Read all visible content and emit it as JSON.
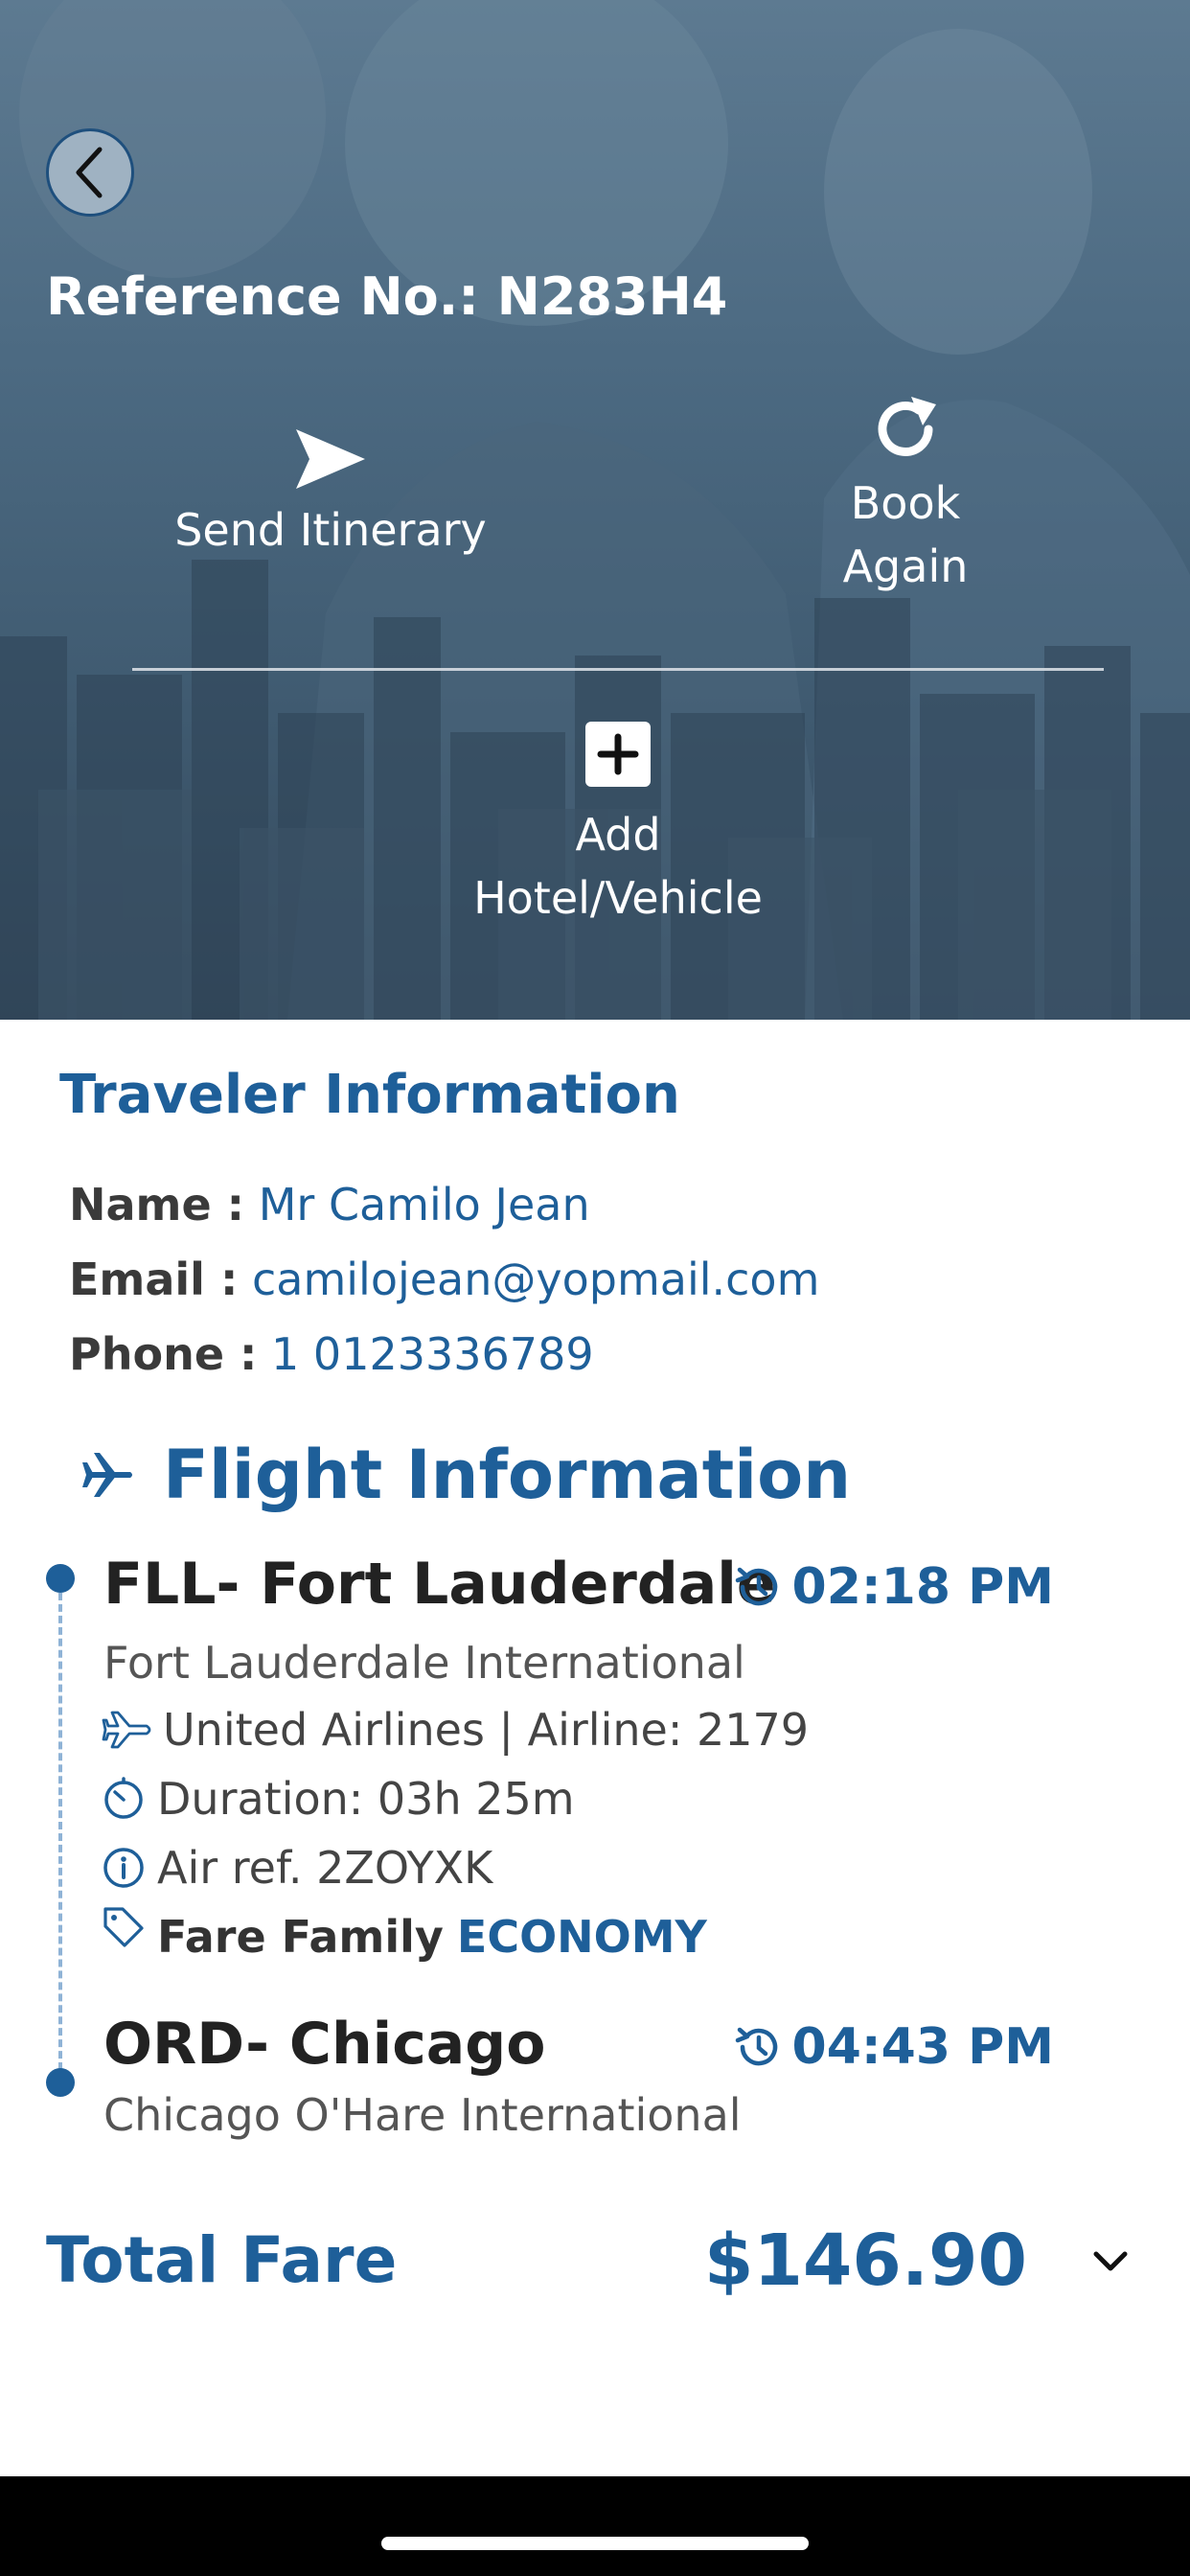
{
  "header": {
    "reference_label": "Reference No.: N283H4"
  },
  "actions": {
    "send_itinerary": "Send Itinerary",
    "book_again_line1": "Book",
    "book_again_line2": "Again",
    "add_line1": "Add",
    "add_line2": "Hotel/Vehicle"
  },
  "traveler": {
    "title": "Traveler Information",
    "name_label": "Name :",
    "name_value": "Mr Camilo Jean",
    "email_label": "Email :",
    "email_value": "camilojean@yopmail.com",
    "phone_label": "Phone :",
    "phone_value": "1 0123336789"
  },
  "flight": {
    "title": "Flight Information",
    "departure": {
      "code_city": "FLL- Fort Lauderdale",
      "time": "02:18 PM",
      "airport": "Fort Lauderdale International"
    },
    "airline": "United Airlines | Airline: 2179",
    "duration": "Duration: 03h 25m",
    "air_ref": "Air ref. 2ZOYXK",
    "fare_family_label": "Fare Family",
    "fare_family_value": "ECONOMY",
    "arrival": {
      "code_city": "ORD- Chicago",
      "time": "04:43 PM",
      "airport": "Chicago O'Hare International"
    }
  },
  "total": {
    "label": "Total Fare",
    "value": "$146.90"
  },
  "icons": {
    "back": "chevron-left-icon",
    "send": "paper-plane-icon",
    "book_again": "refresh-icon",
    "add": "plus-square-icon",
    "flight": "airplane-icon",
    "time": "history-clock-icon",
    "airline": "airplane-outline-icon",
    "duration": "timer-icon",
    "info": "info-icon",
    "tag": "tag-icon",
    "toggle": "chevron-down-icon"
  },
  "colors": {
    "accent": "#1e5f99",
    "text_dark": "#222222",
    "hero_top": "#5d7a91",
    "hero_bottom": "#34495c"
  }
}
